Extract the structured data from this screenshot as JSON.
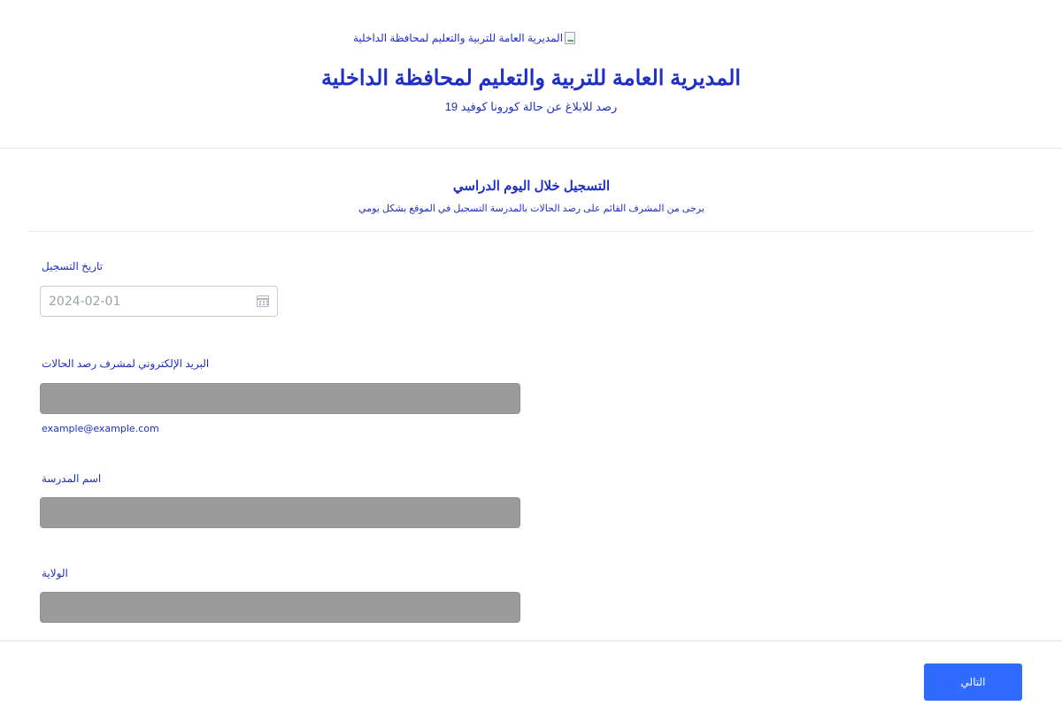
{
  "header": {
    "logo_alt": "المديرية العامة للتربية والتعليم لمحافظة الداخلية",
    "title": "المديرية العامة للتربية والتعليم لمحافظة الداخلية",
    "subtitle": "رصد للابلاغ عن حالة كورونا كوفيد 19"
  },
  "section": {
    "title": "التسجيل خلال اليوم الدراسي",
    "description": "يرجى من المشرف القائم  على رصد الحالات بالمدرسة التسجيل في الموقع بشكل يومي"
  },
  "fields": {
    "date": {
      "label": "تاريخ التسجيل",
      "value": "2024-02-01",
      "icon": "calendar-icon"
    },
    "email": {
      "label": "البريد الإلكتروني لمشرف رصد الحالات",
      "value": "",
      "hint": "example@example.com"
    },
    "school": {
      "label": "اسم المدرسة",
      "value": ""
    },
    "state": {
      "label": "الولاية",
      "value": ""
    }
  },
  "footer": {
    "next_label": "التالي"
  },
  "colors": {
    "text": "#1f2fc4",
    "button": "#2f6bff",
    "field_fill": "#9b9b9b"
  }
}
